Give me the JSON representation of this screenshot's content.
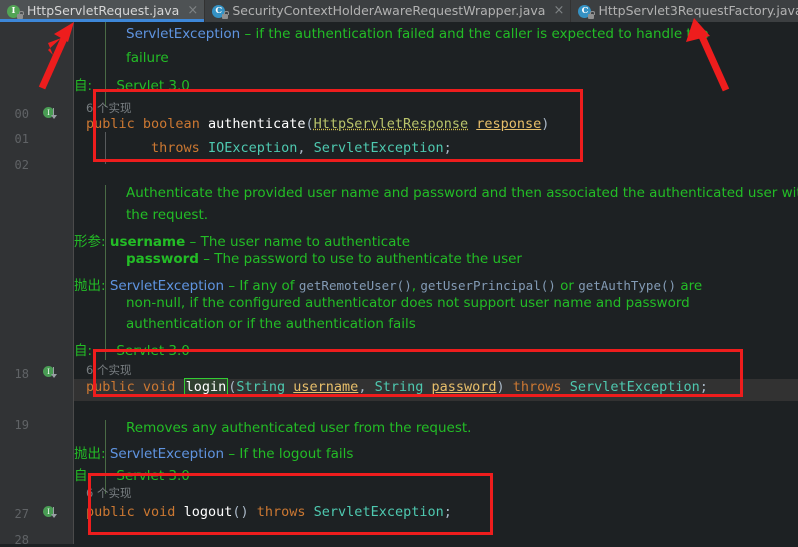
{
  "window": {
    "app": "IntelliJ IDEA editor",
    "colors": {
      "tabbar_bg": "#3c3f41",
      "active_tab_bg": "#4e5254",
      "active_tab_underline": "#3d87d8",
      "editor_bg": "#1d2123",
      "gutter_bg": "#313335",
      "current_line_bg": "#323232",
      "annotation_red": "#ee1d1d",
      "search_match_green": "#33cc33",
      "javadoc_green": "#23bd26",
      "keyword_orange": "#cc7832",
      "type_teal": "#4ec9b0"
    }
  },
  "tabs": [
    {
      "label": "HttpServletRequest.java",
      "icon": "interface-locked-icon",
      "icon_letter": "I",
      "active": true,
      "close_label": "×"
    },
    {
      "label": "SecurityContextHolderAwareRequestWrapper.java",
      "icon": "class-locked-icon",
      "icon_letter": "C",
      "active": false,
      "close_label": "×"
    },
    {
      "label": "HttpServlet3RequestFactory.java",
      "icon": "class-locked-icon",
      "icon_letter": "C",
      "active": false,
      "close_label": "×"
    }
  ],
  "gutter": {
    "line_numbers": [
      "00",
      "01",
      "02",
      "18",
      "19",
      "27",
      "28"
    ],
    "impl_marker_letter": "I",
    "impl_marker_tooltip": "Implemented methods"
  },
  "editor": {
    "lines": [
      {
        "id": "doc-servletexception-1",
        "kind": "javadoc",
        "segments": [
          {
            "text": "ServletException",
            "style": "doclink"
          },
          {
            "text": " – if the authentication failed and the caller is expected to handle the",
            "style": "doc"
          }
        ]
      },
      {
        "id": "doc-failure",
        "kind": "javadoc",
        "segments": [
          {
            "text": "failure",
            "style": "doc"
          }
        ]
      },
      {
        "id": "doc-since-1",
        "kind": "javadoc-tag",
        "tag": "自:",
        "segments": [
          {
            "text": "Servlet 3.0",
            "style": "doc"
          }
        ]
      },
      {
        "id": "impl-count-1",
        "kind": "impl-count",
        "segments": [
          {
            "text": "6 个实现",
            "style": "implcount"
          }
        ]
      },
      {
        "id": "code-authenticate-1",
        "kind": "code",
        "segments": [
          {
            "text": "public",
            "style": "kw"
          },
          {
            "text": " ",
            "style": "punct"
          },
          {
            "text": "boolean",
            "style": "kw"
          },
          {
            "text": " ",
            "style": "punct"
          },
          {
            "text": "authenticate",
            "style": "mname"
          },
          {
            "text": "(",
            "style": "punct"
          },
          {
            "text": "HttpServletResponse",
            "style": "ptype-wavy"
          },
          {
            "text": " ",
            "style": "punct"
          },
          {
            "text": "response",
            "style": "param"
          },
          {
            "text": ")",
            "style": "punct"
          }
        ]
      },
      {
        "id": "code-authenticate-2",
        "kind": "code",
        "segments": [
          {
            "text": "        ",
            "style": "punct"
          },
          {
            "text": "throws",
            "style": "kw"
          },
          {
            "text": " ",
            "style": "punct"
          },
          {
            "text": "IOException",
            "style": "type"
          },
          {
            "text": ", ",
            "style": "punct"
          },
          {
            "text": "ServletException",
            "style": "type"
          },
          {
            "text": ";",
            "style": "punct"
          }
        ]
      },
      {
        "id": "doc-auth-desc-1",
        "kind": "javadoc",
        "segments": [
          {
            "text": "Authenticate the provided user name and password and then associated the authenticated user with",
            "style": "doc"
          }
        ]
      },
      {
        "id": "doc-auth-desc-2",
        "kind": "javadoc",
        "segments": [
          {
            "text": "the request.",
            "style": "doc"
          }
        ]
      },
      {
        "id": "doc-params-username",
        "kind": "javadoc-tag",
        "tag": "形参:",
        "segments": [
          {
            "text": "username",
            "style": "docbold"
          },
          {
            "text": " – The user name to authenticate",
            "style": "doc"
          }
        ]
      },
      {
        "id": "doc-params-password",
        "kind": "javadoc",
        "segments": [
          {
            "text": "password",
            "style": "docbold"
          },
          {
            "text": " – The password to use to authenticate the user",
            "style": "doc"
          }
        ]
      },
      {
        "id": "doc-throws-1",
        "kind": "javadoc-tag",
        "tag": "抛出:",
        "segments": [
          {
            "text": "ServletException",
            "style": "doclink"
          },
          {
            "text": " – If any of ",
            "style": "doc"
          },
          {
            "text": "getRemoteUser()",
            "style": "docmono"
          },
          {
            "text": ", ",
            "style": "doc"
          },
          {
            "text": "getUserPrincipal()",
            "style": "docmono"
          },
          {
            "text": " or ",
            "style": "doc"
          },
          {
            "text": "getAuthType()",
            "style": "docmono"
          },
          {
            "text": " are",
            "style": "doc"
          }
        ]
      },
      {
        "id": "doc-throws-2",
        "kind": "javadoc",
        "segments": [
          {
            "text": "non-null, if the configured authenticator does not support user name and password",
            "style": "doc"
          }
        ]
      },
      {
        "id": "doc-throws-3",
        "kind": "javadoc",
        "segments": [
          {
            "text": "authentication or if the authentication fails",
            "style": "doc"
          }
        ]
      },
      {
        "id": "doc-since-2",
        "kind": "javadoc-tag",
        "tag": "自:",
        "segments": [
          {
            "text": "Servlet 3.0",
            "style": "doc"
          }
        ]
      },
      {
        "id": "impl-count-2",
        "kind": "impl-count",
        "segments": [
          {
            "text": "6 个实现",
            "style": "implcount"
          }
        ]
      },
      {
        "id": "code-login",
        "kind": "code",
        "highlighted": true,
        "segments": [
          {
            "text": "public",
            "style": "kw"
          },
          {
            "text": " ",
            "style": "punct"
          },
          {
            "text": "void",
            "style": "kw"
          },
          {
            "text": " ",
            "style": "punct"
          },
          {
            "text": "login",
            "style": "match"
          },
          {
            "text": "(",
            "style": "punct"
          },
          {
            "text": "String",
            "style": "type"
          },
          {
            "text": " ",
            "style": "punct"
          },
          {
            "text": "username",
            "style": "param"
          },
          {
            "text": ", ",
            "style": "punct"
          },
          {
            "text": "String",
            "style": "type"
          },
          {
            "text": " ",
            "style": "punct"
          },
          {
            "text": "password",
            "style": "param"
          },
          {
            "text": ") ",
            "style": "punct"
          },
          {
            "text": "throws",
            "style": "kw"
          },
          {
            "text": " ",
            "style": "punct"
          },
          {
            "text": "ServletException",
            "style": "type"
          },
          {
            "text": ";",
            "style": "punct"
          }
        ]
      },
      {
        "id": "doc-logout-desc",
        "kind": "javadoc",
        "segments": [
          {
            "text": "Removes any authenticated user from the request.",
            "style": "doc"
          }
        ]
      },
      {
        "id": "doc-logout-throws",
        "kind": "javadoc-tag",
        "tag": "抛出:",
        "segments": [
          {
            "text": "ServletException",
            "style": "doclink"
          },
          {
            "text": " – If the logout fails",
            "style": "doc"
          }
        ]
      },
      {
        "id": "doc-since-3",
        "kind": "javadoc-tag",
        "tag": "自:",
        "segments": [
          {
            "text": "Servlet 3.0",
            "style": "doc"
          }
        ]
      },
      {
        "id": "impl-count-3",
        "kind": "impl-count",
        "segments": [
          {
            "text": "6 个实现",
            "style": "implcount"
          }
        ]
      },
      {
        "id": "code-logout",
        "kind": "code",
        "segments": [
          {
            "text": "public",
            "style": "kw"
          },
          {
            "text": " ",
            "style": "punct"
          },
          {
            "text": "void",
            "style": "kw"
          },
          {
            "text": " ",
            "style": "punct"
          },
          {
            "text": "logout",
            "style": "mname"
          },
          {
            "text": "() ",
            "style": "punct"
          },
          {
            "text": "throws",
            "style": "kw"
          },
          {
            "text": " ",
            "style": "punct"
          },
          {
            "text": "ServletException",
            "style": "type"
          },
          {
            "text": ";",
            "style": "punct"
          }
        ]
      }
    ]
  },
  "annotations": {
    "red_boxes": [
      {
        "name": "authenticate-method-box"
      },
      {
        "name": "login-method-box"
      },
      {
        "name": "logout-method-box"
      }
    ],
    "red_arrows": [
      {
        "name": "arrow-to-first-tab",
        "points_at": "HttpServletRequest.java"
      },
      {
        "name": "arrow-to-third-tab",
        "points_at": "HttpServlet3RequestFactory.java"
      }
    ]
  }
}
